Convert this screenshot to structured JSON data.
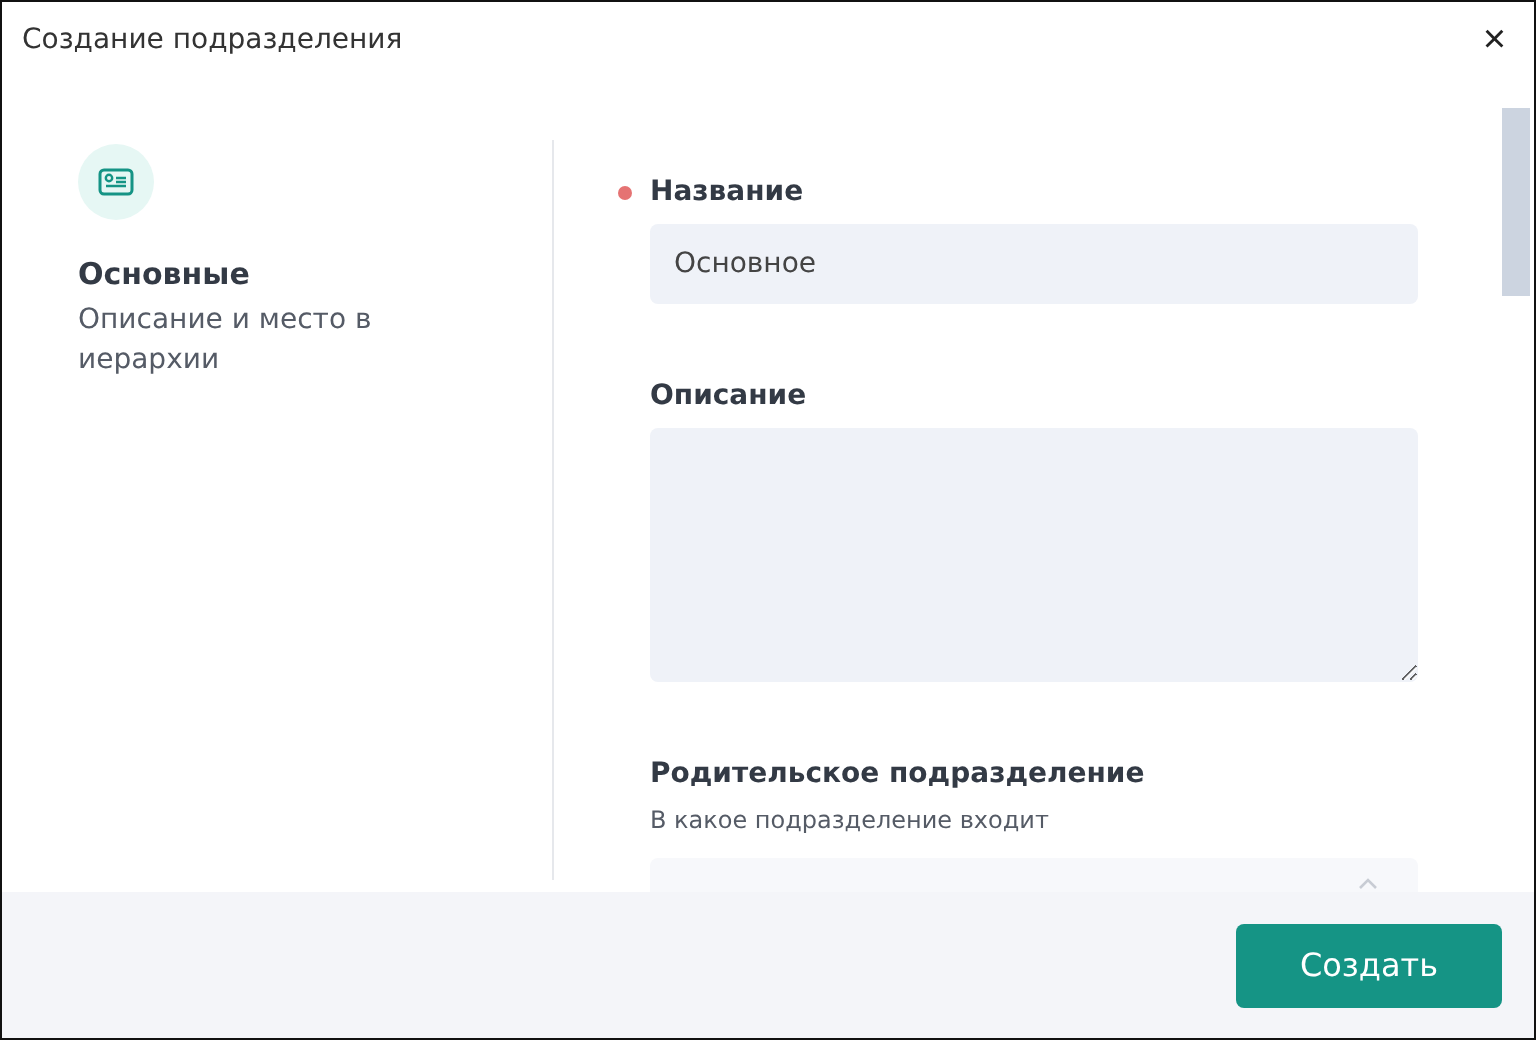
{
  "window": {
    "title": "Создание подразделения",
    "close": "×"
  },
  "section": {
    "title": "Основные",
    "description": "Описание и место в иерархии"
  },
  "fields": [
    {
      "kind": "input",
      "label": "Название",
      "required": true,
      "value": "Основное"
    },
    {
      "kind": "textarea",
      "label": "Описание",
      "required": false
    },
    {
      "kind": "select",
      "label": "Родительское подразделение",
      "required": false,
      "hint": "В какое подразделение входит"
    }
  ],
  "buttons": [
    "Создать"
  ]
}
